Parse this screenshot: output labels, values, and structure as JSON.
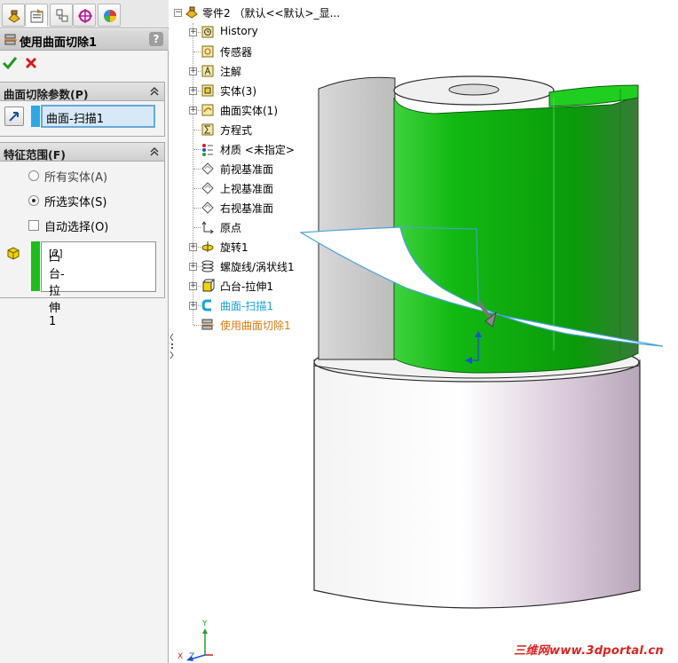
{
  "property_manager": {
    "title": "使用曲面切除1",
    "help": "?",
    "tabs": [
      "feature-manager",
      "property-manager",
      "configuration-manager",
      "dimxpert-manager",
      "display-manager"
    ],
    "confirm_icon": "check-icon",
    "cancel_icon": "x-icon",
    "params_group": {
      "title": "曲面切除参数(P)",
      "surface": "曲面-扫描1"
    },
    "scope_group": {
      "title": "特征范围(F)",
      "all_bodies": "所有实体(A)",
      "selected_bodies": "所选实体(S)",
      "selected_option": "selected_bodies",
      "auto_select": "自动选择(O)",
      "auto_select_checked": false,
      "body_name": "凸台-拉伸1",
      "body_count": "[2]"
    }
  },
  "tree": {
    "root": "零件2 （默认<<默认>_显...",
    "items": [
      {
        "label": "History",
        "icon": "history-icon"
      },
      {
        "label": "传感器",
        "icon": "sensor-icon"
      },
      {
        "label": "注解",
        "icon": "annotation-icon"
      },
      {
        "label": "实体(3)",
        "icon": "solid-bodies-icon"
      },
      {
        "label": "曲面实体(1)",
        "icon": "surface-bodies-icon"
      },
      {
        "label": "方程式",
        "icon": "equation-icon"
      },
      {
        "label": "材质 <未指定>",
        "icon": "material-icon"
      },
      {
        "label": "前视基准面",
        "icon": "plane-icon"
      },
      {
        "label": "上视基准面",
        "icon": "plane-icon"
      },
      {
        "label": "右视基准面",
        "icon": "plane-icon"
      },
      {
        "label": "原点",
        "icon": "origin-icon"
      },
      {
        "label": "旋转1",
        "icon": "revolve-icon"
      },
      {
        "label": "螺旋线/涡状线1",
        "icon": "helix-icon"
      },
      {
        "label": "凸台-拉伸1",
        "icon": "extrude-icon"
      },
      {
        "label": "曲面-扫描1",
        "icon": "sweep-surface-icon"
      },
      {
        "label": "使用曲面切除1",
        "icon": "surface-cut-icon"
      }
    ]
  },
  "colors": {
    "highlight_blue": "#19a2e6",
    "cut_orange": "#e07b12",
    "selected_body_green": "#18c018",
    "watermark_red": "#e0201e"
  },
  "watermark": "三维网www.3dportal.cn",
  "triad": {
    "x": "X",
    "y": "Y",
    "z": "Z"
  }
}
